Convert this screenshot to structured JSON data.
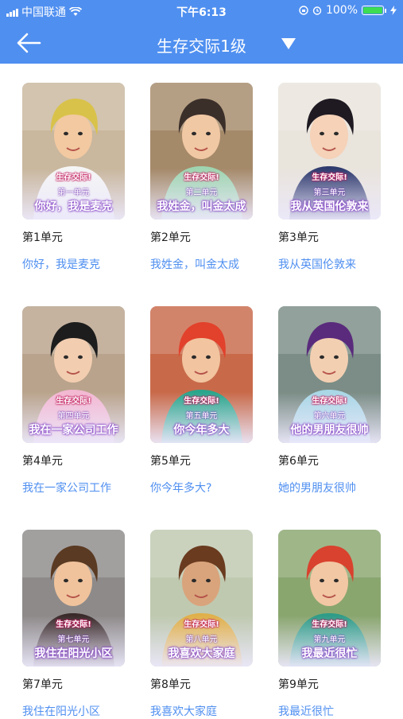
{
  "status_bar": {
    "carrier": "中国联通",
    "time": "下午6:13",
    "battery": "100%",
    "icons": [
      "signal-icon",
      "wifi-icon",
      "lock-rotation-icon",
      "alarm-icon",
      "battery-icon",
      "charging-icon"
    ]
  },
  "header": {
    "title": "生存交际1级",
    "back_icon": "arrow-left-icon",
    "dropdown_icon": "caret-down-icon"
  },
  "colors": {
    "accent": "#4f8ff0",
    "link": "#4f8ff0",
    "badge_pink": "#c2185b",
    "badge_purple": "#8a4cc9"
  },
  "cover_badge": "生存交际!",
  "units": [
    {
      "label": "第1单元",
      "subtitle": "你好，我是麦克",
      "cover_unit": "第一单元",
      "cover_title": "你好，我是麦克"
    },
    {
      "label": "第2单元",
      "subtitle": "我姓金，叫金太成",
      "cover_unit": "第二单元",
      "cover_title": "我姓金，叫金太成"
    },
    {
      "label": "第3单元",
      "subtitle": "我从英国伦敦来",
      "cover_unit": "第三单元",
      "cover_title": "我从英国伦敦来"
    },
    {
      "label": "第4单元",
      "subtitle": "我在一家公司工作",
      "cover_unit": "第四单元",
      "cover_title": "我在一家公司工作"
    },
    {
      "label": "第5单元",
      "subtitle": "你今年多大?",
      "cover_unit": "第五单元",
      "cover_title": "你今年多大"
    },
    {
      "label": "第6单元",
      "subtitle": "她的男朋友很帅",
      "cover_unit": "第六单元",
      "cover_title": "他的男朋友很帅"
    },
    {
      "label": "第7单元",
      "subtitle": "我住在阳光小区",
      "cover_unit": "第七单元",
      "cover_title": "我住在阳光小区"
    },
    {
      "label": "第8单元",
      "subtitle": "我喜欢大家庭",
      "cover_unit": "第八单元",
      "cover_title": "我喜欢大家庭"
    },
    {
      "label": "第9单元",
      "subtitle": "我最近很忙",
      "cover_unit": "第九单元",
      "cover_title": "我最近很忙"
    }
  ]
}
